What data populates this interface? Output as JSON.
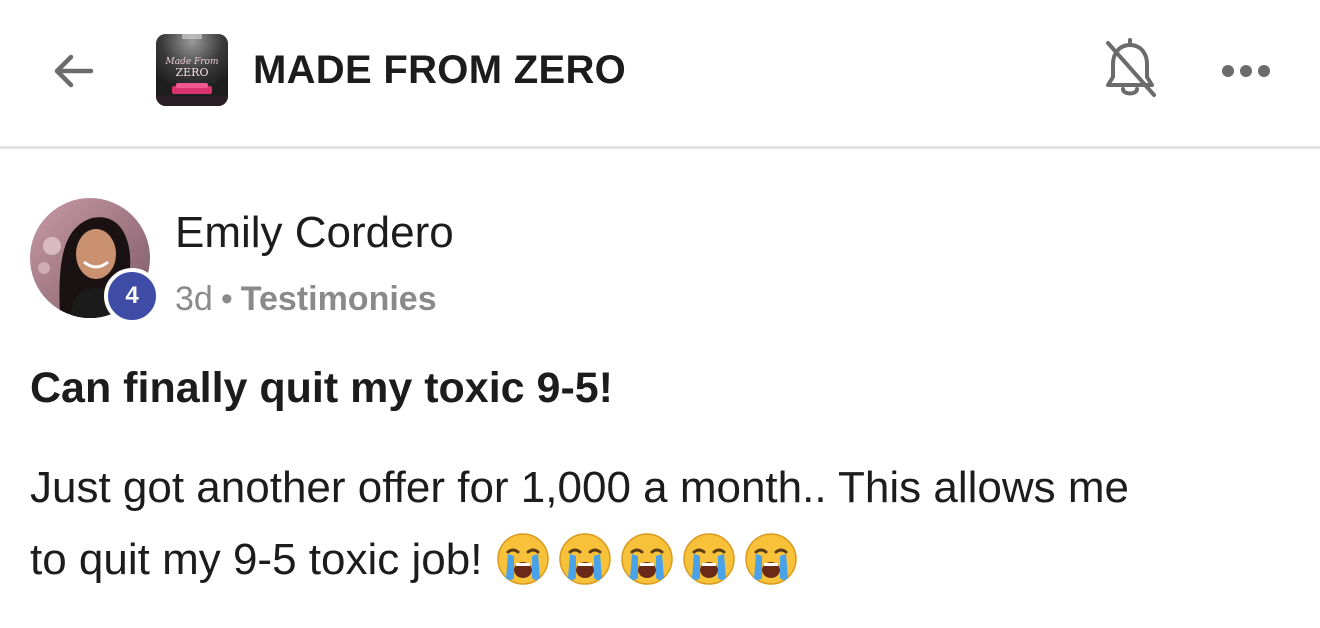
{
  "header": {
    "title": "MADE FROM ZERO",
    "icons": {
      "back": "arrow-left-icon",
      "group_logo": "group-logo",
      "notifications": "bell-off-icon",
      "more": "more-horizontal-icon"
    }
  },
  "post": {
    "author": {
      "name": "Emily Cordero",
      "level": "4"
    },
    "time": "3d",
    "separator": "•",
    "category": "Testimonies",
    "title": "Can finally quit my toxic 9-5!",
    "body_line1": "Just got another offer for 1,000 a month.. This allows me",
    "body_line2": "to quit my 9-5 toxic job!",
    "emojis": [
      "loudly-crying-face",
      "loudly-crying-face",
      "loudly-crying-face",
      "loudly-crying-face",
      "loudly-crying-face"
    ]
  },
  "colors": {
    "badge": "#3f4ca6",
    "muted_text": "#8a8a8a",
    "divider": "#e3e3e3",
    "emoji_yellow": "#f7c23a"
  }
}
